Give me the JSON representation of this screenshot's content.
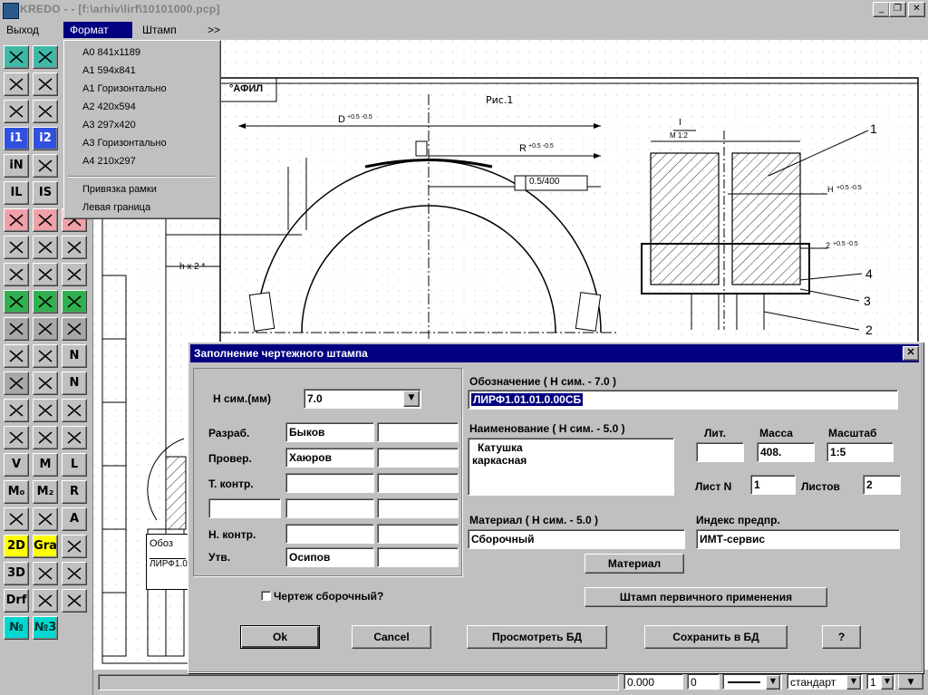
{
  "window": {
    "title": "KREDO - - [f:\\arhiv\\lirf\\10101000.pcp]",
    "min_glyph": "_",
    "max_glyph": "❐",
    "close_glyph": "✕"
  },
  "menu": {
    "items": [
      "Выход",
      "Формат",
      "Штамп",
      ">>"
    ],
    "active": "Формат"
  },
  "format_menu": {
    "items": [
      "А0 841х1189",
      "А1 594х841",
      "А1 Горизонтально",
      "А2 420х594",
      "А3 297х420",
      "А3 Горизонтально",
      "А4 210х297"
    ],
    "extra_items": [
      "Привязка рамки",
      "Левая граница"
    ]
  },
  "toolbar": {
    "colors": {
      "teal": "#3fb8a8",
      "pink": "#f0a0a8",
      "green": "#30b050",
      "yellow": "#ffff00",
      "blue": "#3050e0",
      "gray": "#a8a8a8"
    },
    "buttons": [
      {
        "name": "crosshatch-icon",
        "label": ""
      },
      {
        "name": "line-icon",
        "label": ""
      },
      {
        "name": "arc-icon",
        "label": ""
      },
      {
        "name": "wave-icon",
        "label": ""
      },
      {
        "name": "rectangle-icon",
        "label": ""
      },
      {
        "name": "ellipse-icon",
        "label": ""
      },
      {
        "name": "info-1-icon",
        "label": "i1"
      },
      {
        "name": "info-2-icon",
        "label": "i2"
      },
      {
        "name": "info-n-icon",
        "label": "iN"
      },
      {
        "name": "info-fit-icon",
        "label": ""
      },
      {
        "name": "tool-il-icon",
        "label": "IL"
      },
      {
        "name": "tool-is-icon",
        "label": "IS"
      },
      {
        "name": "select-pink-a-icon",
        "label": ""
      },
      {
        "name": "select-pink-b-icon",
        "label": ""
      },
      {
        "name": "people-icon",
        "label": ""
      },
      {
        "name": "trim-icon",
        "label": ""
      },
      {
        "name": "fillet-icon",
        "label": ""
      },
      {
        "name": "chamfer-icon",
        "label": ""
      },
      {
        "name": "cut-a-icon",
        "label": ""
      },
      {
        "name": "cut-b-icon",
        "label": ""
      },
      {
        "name": "scissors-icon",
        "label": ""
      },
      {
        "name": "layer-green-a-icon",
        "label": ""
      },
      {
        "name": "layer-green-b-icon",
        "label": ""
      },
      {
        "name": "layer-green-c-icon",
        "label": ""
      },
      {
        "name": "layer-gray-a-icon",
        "label": ""
      },
      {
        "name": "layer-gray-b-icon",
        "label": ""
      },
      {
        "name": "layer-gray-c-icon",
        "label": ""
      },
      {
        "name": "lasso-icon",
        "label": ""
      },
      {
        "name": "pointer-icon",
        "label": ""
      },
      {
        "name": "normal-icon",
        "label": "N"
      },
      {
        "name": "pin-icon",
        "label": ""
      },
      {
        "name": "pointer-2-icon",
        "label": ""
      },
      {
        "name": "normal-2-icon",
        "label": "N"
      },
      {
        "name": "window-icon",
        "label": ""
      },
      {
        "name": "copy-icon",
        "label": ""
      },
      {
        "name": "grid-icon",
        "label": ""
      },
      {
        "name": "anchor-icon",
        "label": ""
      },
      {
        "name": "fork-icon",
        "label": ""
      },
      {
        "name": "branch-icon",
        "label": ""
      },
      {
        "name": "tool-v-icon",
        "label": "V"
      },
      {
        "name": "tool-m-icon",
        "label": "M"
      },
      {
        "name": "tool-l-icon",
        "label": "L"
      },
      {
        "name": "tool-m0-icon",
        "label": "M₀"
      },
      {
        "name": "tool-mz-icon",
        "label": "M₂"
      },
      {
        "name": "tool-r-icon",
        "label": "R"
      },
      {
        "name": "magnify-icon",
        "label": ""
      },
      {
        "name": "frame-icon",
        "label": ""
      },
      {
        "name": "text-a-icon",
        "label": "A"
      },
      {
        "name": "mode-2d-icon",
        "label": "2D"
      },
      {
        "name": "graphics-icon",
        "label": "Gra"
      },
      {
        "name": "lips-icon",
        "label": ""
      },
      {
        "name": "mode-3d-icon",
        "label": "3D"
      },
      {
        "name": "layers-icon",
        "label": ""
      },
      {
        "name": "brain-icon",
        "label": ""
      },
      {
        "name": "draft-icon",
        "label": "Drf"
      },
      {
        "name": "angle-icon",
        "label": ""
      },
      {
        "name": "stretch-icon",
        "label": ""
      },
      {
        "name": "numbering-icon",
        "label": "№"
      },
      {
        "name": "numbering-3-icon",
        "label": "№3"
      }
    ]
  },
  "drawing": {
    "fragment_title": "°АФИЛ",
    "fig_label": "Рис.1",
    "dim_d": "D",
    "dim_d_tol": "+0.5 -0.5",
    "dim_r": "R",
    "dim_r_tol": "+0.5 -0.5",
    "dim_box": "0.5/400",
    "dim_hx2": "h x 2 *",
    "section_label": "I",
    "section_scale": "M 1:2",
    "dim_h": "H",
    "dim_h_tol": "+0.5 -0.5",
    "dim_2": "2",
    "dim_2_tol": "+0.5 -0.5",
    "callout_1": "1",
    "callout_2": "2",
    "callout_3": "3",
    "callout_4": "4",
    "stamp_cell_1": "Обоз",
    "stamp_cell_2": "ЛИРФ1.0"
  },
  "dialog": {
    "title": "Заполнение чертежного штампа",
    "h_label": "H сим.(мм)",
    "h_value": "7.0",
    "designation_label": "Обозначение  ( H сим. -     7.0    )",
    "designation_value": "ЛИРФ1.01.01.0.00СБ",
    "name_label": "Наименование  ( H сим. -   5.0   )",
    "name_value_lines": [
      "Катушка",
      "каркасная"
    ],
    "lit_label": "Лит.",
    "lit_value": "",
    "mass_label": "Масса",
    "mass_value": "408.",
    "scale_label": "Масштаб",
    "scale_value": "1:5",
    "sheet_label": "Лист N",
    "sheet_value": "1",
    "sheets_label": "Листов",
    "sheets_value": "2",
    "material_label": "Материал  ( H сим. -    5.0   )",
    "material_value": "Сборочный",
    "enterprise_label": "Индекс предпр.",
    "enterprise_value": "ИМТ-сервис",
    "signatures": [
      {
        "role": "Разраб.",
        "name": "Быков"
      },
      {
        "role": "Провер.",
        "name": "Хаюров"
      },
      {
        "role": "Т. контр.",
        "name": ""
      },
      {
        "role": "",
        "name": ""
      },
      {
        "role": "Н. контр.",
        "name": ""
      },
      {
        "role": "Утв.",
        "name": "Осипов"
      }
    ],
    "assembly_checkbox_label": "Чертеж сборочный?",
    "assembly_checked": false,
    "material_button": "Материал",
    "primary_stamp_button": "Штамп первичного применения",
    "ok_button": "Ok",
    "cancel_button": "Cancel",
    "view_db_button": "Просмотреть БД",
    "save_db_button": "Сохранить в БД",
    "help_button": "?"
  },
  "status": {
    "coord_x": "0.000",
    "coord_y": "0",
    "line_style": "",
    "font": "стандарт",
    "layer": "1"
  }
}
